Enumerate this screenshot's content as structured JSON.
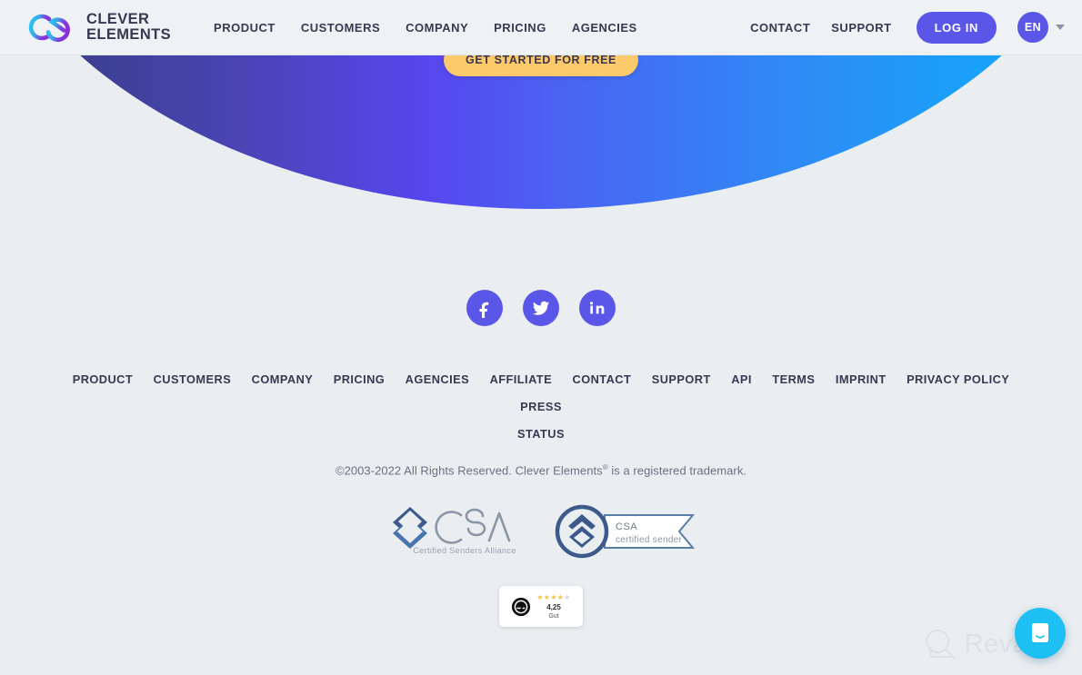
{
  "header": {
    "brand": {
      "line1": "CLEVER",
      "line2": "ELEMENTS",
      "logo_icon": "clever-elements-ce-logo"
    },
    "nav": [
      {
        "label": "PRODUCT"
      },
      {
        "label": "CUSTOMERS"
      },
      {
        "label": "COMPANY"
      },
      {
        "label": "PRICING"
      },
      {
        "label": "AGENCIES"
      }
    ],
    "right_links": [
      {
        "label": "CONTACT"
      },
      {
        "label": "SUPPORT"
      }
    ],
    "login_label": "LOG IN",
    "language": "EN",
    "language_chevron_icon": "chevron-down-icon"
  },
  "hero": {
    "cta_label": "GET STARTED FOR FREE",
    "gradient_start": "#33387d",
    "gradient_mid": "#5746ee",
    "gradient_end": "#14a9f7",
    "cta_color": "#fcca6b"
  },
  "footer": {
    "socials": [
      {
        "name": "facebook-icon",
        "label": "Facebook"
      },
      {
        "name": "twitter-icon",
        "label": "Twitter"
      },
      {
        "name": "linkedin-icon",
        "label": "LinkedIn"
      }
    ],
    "social_color": "#5a56e8",
    "links": [
      {
        "label": "PRODUCT"
      },
      {
        "label": "CUSTOMERS"
      },
      {
        "label": "COMPANY"
      },
      {
        "label": "PRICING"
      },
      {
        "label": "AGENCIES"
      },
      {
        "label": "AFFILIATE"
      },
      {
        "label": "CONTACT"
      },
      {
        "label": "SUPPORT"
      },
      {
        "label": "API"
      },
      {
        "label": "TERMS"
      },
      {
        "label": "IMPRINT"
      },
      {
        "label": "PRIVACY POLICY"
      },
      {
        "label": "PRESS"
      },
      {
        "label": "STATUS"
      }
    ],
    "copyright_before": "©2003-2022 All Rights Reserved. Clever Elements",
    "copyright_sup": "®",
    "copyright_after": " is a registered trademark.",
    "certifications": [
      {
        "name": "csa-certified-senders-alliance-logo",
        "title": "CSA",
        "subtitle": "Certified Senders Alliance"
      },
      {
        "name": "csa-certified-sender-badge",
        "title": "CSA",
        "subtitle": "certified sender"
      }
    ],
    "review_widget": {
      "provider_icon": "ekomi-e-logo",
      "stars_filled": 4,
      "stars_total": 5,
      "rating": "4,25",
      "rating_label": "Gut"
    }
  },
  "overlays": {
    "watermark_text": "Revain",
    "watermark_icon": "revain-magnifier-icon",
    "chat_icon": "intercom-chat-icon",
    "chat_color": "#1ec0f3"
  }
}
